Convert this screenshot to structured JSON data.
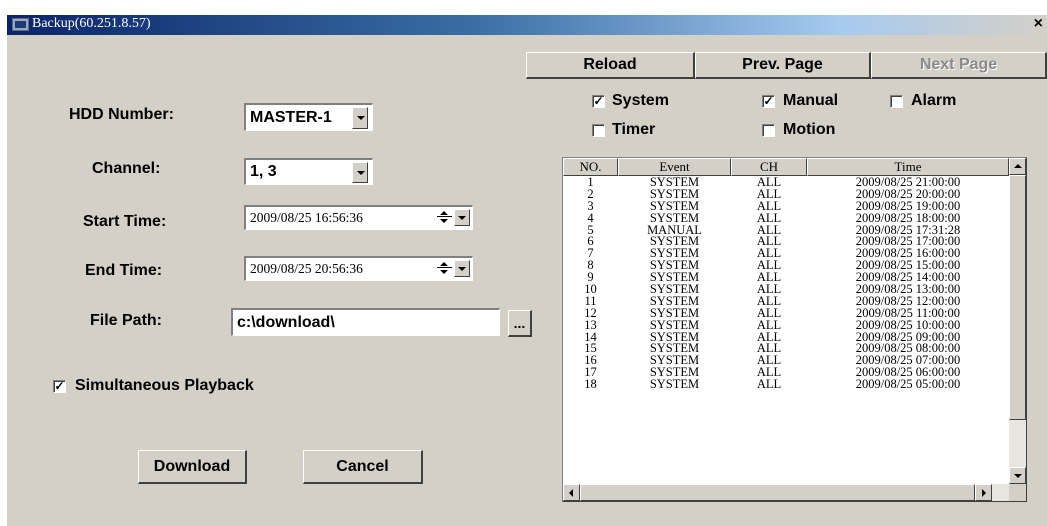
{
  "window": {
    "title": "Backup(60.251.8.57)"
  },
  "toolbar": {
    "reload": "Reload",
    "prev_page": "Prev. Page",
    "next_page": "Next Page"
  },
  "filters": {
    "system": {
      "label": "System",
      "checked": true
    },
    "manual": {
      "label": "Manual",
      "checked": true
    },
    "alarm": {
      "label": "Alarm",
      "checked": false
    },
    "timer": {
      "label": "Timer",
      "checked": false
    },
    "motion": {
      "label": "Motion",
      "checked": false
    }
  },
  "form": {
    "hdd_label": "HDD Number:",
    "hdd_value": "MASTER-1",
    "channel_label": "Channel:",
    "channel_value": "1, 3",
    "start_label": "Start Time:",
    "start_value": "2009/08/25 16:56:36",
    "end_label": "End Time:",
    "end_value": "2009/08/25 20:56:36",
    "path_label": "File Path:",
    "path_value": "c:\\download\\",
    "browse_label": "...",
    "simul_label": "Simultaneous Playback",
    "simul_checked": true,
    "download": "Download",
    "cancel": "Cancel"
  },
  "table": {
    "headers": [
      "NO.",
      "Event",
      "CH",
      "Time"
    ],
    "rows": [
      [
        "1",
        "SYSTEM",
        "ALL",
        "2009/08/25 21:00:00"
      ],
      [
        "2",
        "SYSTEM",
        "ALL",
        "2009/08/25 20:00:00"
      ],
      [
        "3",
        "SYSTEM",
        "ALL",
        "2009/08/25 19:00:00"
      ],
      [
        "4",
        "SYSTEM",
        "ALL",
        "2009/08/25 18:00:00"
      ],
      [
        "5",
        "MANUAL",
        "ALL",
        "2009/08/25 17:31:28"
      ],
      [
        "6",
        "SYSTEM",
        "ALL",
        "2009/08/25 17:00:00"
      ],
      [
        "7",
        "SYSTEM",
        "ALL",
        "2009/08/25 16:00:00"
      ],
      [
        "8",
        "SYSTEM",
        "ALL",
        "2009/08/25 15:00:00"
      ],
      [
        "9",
        "SYSTEM",
        "ALL",
        "2009/08/25 14:00:00"
      ],
      [
        "10",
        "SYSTEM",
        "ALL",
        "2009/08/25 13:00:00"
      ],
      [
        "11",
        "SYSTEM",
        "ALL",
        "2009/08/25 12:00:00"
      ],
      [
        "12",
        "SYSTEM",
        "ALL",
        "2009/08/25 11:00:00"
      ],
      [
        "13",
        "SYSTEM",
        "ALL",
        "2009/08/25 10:00:00"
      ],
      [
        "14",
        "SYSTEM",
        "ALL",
        "2009/08/25 09:00:00"
      ],
      [
        "15",
        "SYSTEM",
        "ALL",
        "2009/08/25 08:00:00"
      ],
      [
        "16",
        "SYSTEM",
        "ALL",
        "2009/08/25 07:00:00"
      ],
      [
        "17",
        "SYSTEM",
        "ALL",
        "2009/08/25 06:00:00"
      ],
      [
        "18",
        "SYSTEM",
        "ALL",
        "2009/08/25 05:00:00"
      ]
    ]
  }
}
